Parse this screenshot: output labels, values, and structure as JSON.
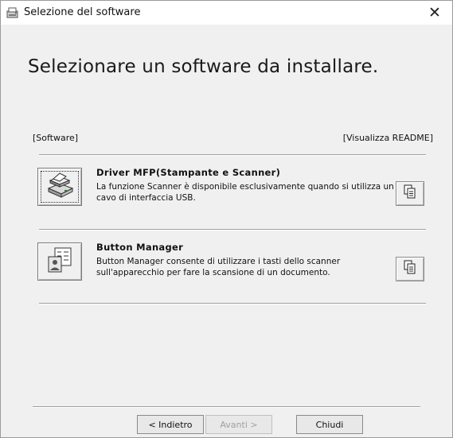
{
  "window": {
    "title": "Selezione del software",
    "close_symbol": "✕",
    "icon": "installer-icon"
  },
  "heading": "Selezionare un software da installare.",
  "list_header": {
    "left": "[Software]",
    "right": "[Visualizza README]"
  },
  "items": [
    {
      "title": "Driver MFP(Stampante e Scanner)",
      "description": "La funzione Scanner è disponibile esclusivamente quando si utilizza un cavo di interfaccia USB.",
      "icon": "printer-scanner-icon",
      "readme_icon": "document-copy-icon"
    },
    {
      "title": "Button Manager",
      "description": "Button Manager consente di utilizzare i tasti dello scanner sull'apparecchio per fare la scansione di un documento.",
      "icon": "button-manager-icon",
      "readme_icon": "document-copy-icon"
    }
  ],
  "buttons": {
    "back": "< Indietro",
    "next": "Avanti >",
    "close": "Chiudi"
  },
  "colors": {
    "window_bg": "#f0f0f0",
    "titlebar_bg": "#ffffff",
    "disabled_text": "#a0a0a0"
  }
}
